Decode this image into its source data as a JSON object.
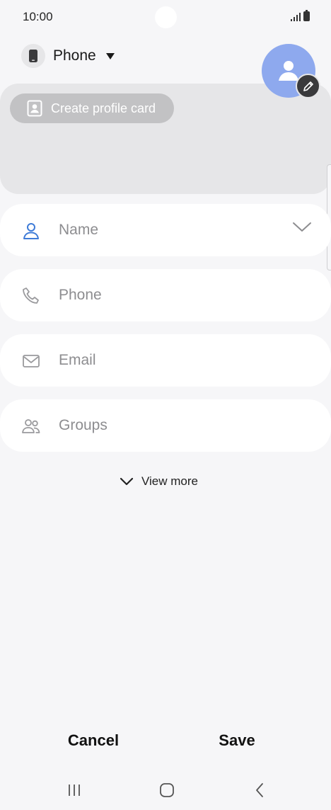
{
  "status_bar": {
    "time": "10:00",
    "icons": [
      "signal-icon",
      "battery-icon"
    ]
  },
  "account": {
    "label": "Phone",
    "icon": "phone-device-icon",
    "dropdown_icon": "caret-down-icon"
  },
  "profile_card": {
    "create_label": "Create profile card",
    "create_icon": "profile-card-icon",
    "avatar_icon": "person-avatar-icon",
    "edit_icon": "pencil-icon",
    "avatar_color": "#8ea9ee"
  },
  "fields": [
    {
      "label": "Name",
      "icon": "person-icon",
      "expand_icon": "chevron-down-icon"
    },
    {
      "label": "Phone",
      "icon": "phone-handset-icon"
    },
    {
      "label": "Email",
      "icon": "envelope-icon"
    },
    {
      "label": "Groups",
      "icon": "group-icon"
    }
  ],
  "view_more": {
    "label": "View more",
    "icon": "chevron-down-icon"
  },
  "actions": {
    "cancel": "Cancel",
    "save": "Save"
  },
  "nav": {
    "recents": "recent-apps-icon",
    "home": "home-icon",
    "back": "back-icon"
  },
  "colors": {
    "background": "#f6f6f8",
    "accent": "#3e7bd7",
    "field": "#ffffff",
    "placeholder": "#8d8d90"
  }
}
